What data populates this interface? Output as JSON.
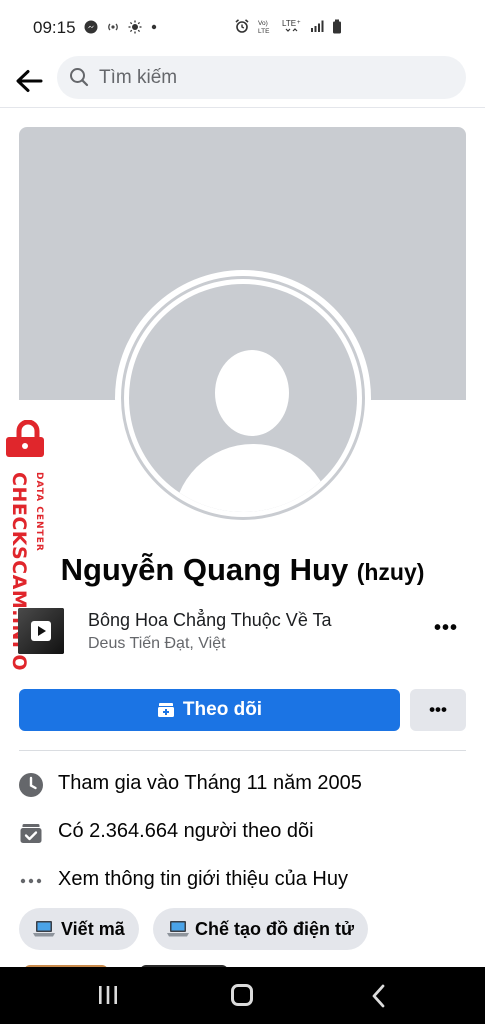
{
  "status_bar": {
    "time": "09:15",
    "left_icons": [
      "messenger-icon",
      "hotspot-icon",
      "brightness-icon",
      "dot-icon"
    ],
    "right_icons": [
      "alarm-icon",
      "volte-icon",
      "lte-icon",
      "signal-icon",
      "battery-icon"
    ]
  },
  "search": {
    "placeholder": "Tìm kiếm"
  },
  "watermark": {
    "text": "CHECKSCAM.INFO",
    "subtext": "DATA CENTER"
  },
  "profile": {
    "name": "Nguyễn Quang Huy",
    "alternate_name": "(hzuy)"
  },
  "music": {
    "title": "Bông Hoa Chẳng Thuộc Về Ta",
    "artist": "Deus Tiến Đạt, Việt",
    "more_label": "•••"
  },
  "actions": {
    "follow_label": "Theo dõi",
    "more_label": "•••"
  },
  "info": [
    {
      "icon": "clock-icon",
      "text": "Tham gia vào Tháng 11 năm 2005"
    },
    {
      "icon": "followers-icon",
      "text": "Có 2.364.664 người theo dõi"
    },
    {
      "icon": "ellipsis-icon",
      "text": "Xem thông tin giới thiệu của Huy"
    }
  ],
  "hobbies": [
    {
      "icon": "laptop-icon",
      "label": "Viết mã"
    },
    {
      "icon": "laptop-icon",
      "label": "Chế tạo đồ điện tử"
    }
  ],
  "colors": {
    "accent": "#1b74e4",
    "watermark": "#e0262c",
    "placeholder_gray": "#c9ccd1"
  }
}
